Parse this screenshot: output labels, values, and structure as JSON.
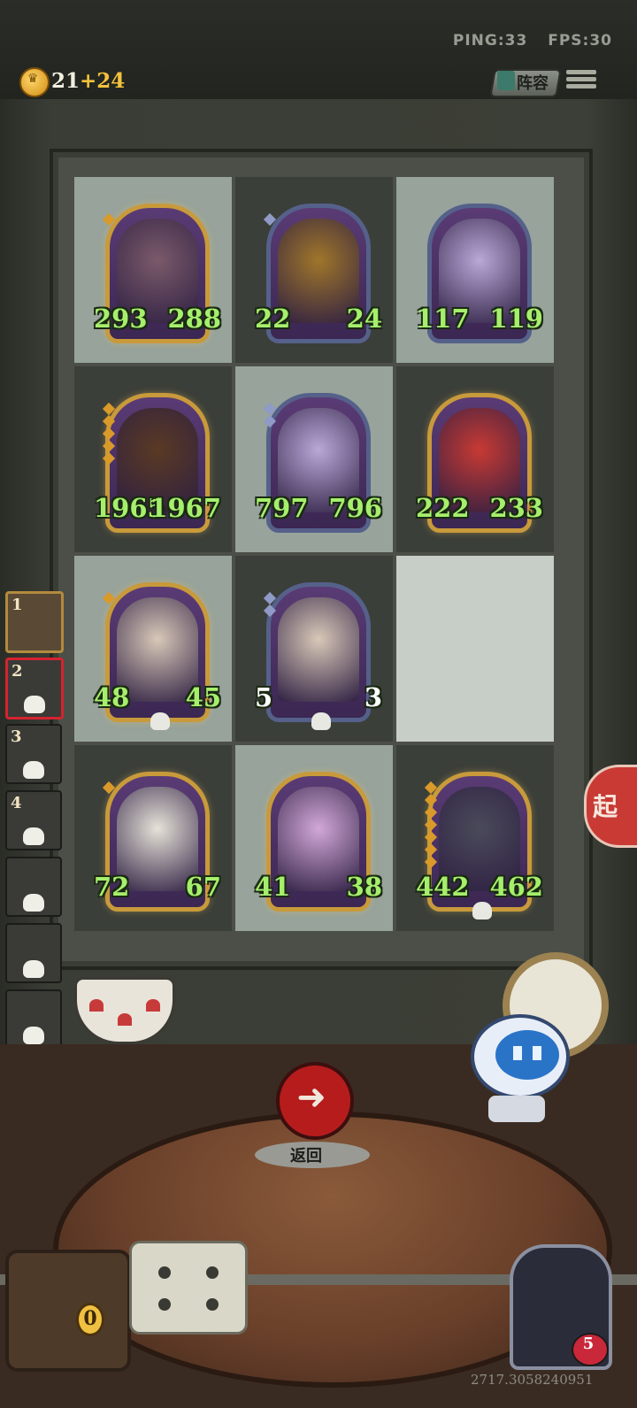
{
  "status": {
    "ping": "PING:33",
    "fps": "FPS:30"
  },
  "economy": {
    "gold": "21",
    "gold_income": "+24"
  },
  "header": {
    "lineup_label": "阵容"
  },
  "board": {
    "cells": [
      {
        "row": 0,
        "col": 0,
        "tone": "light",
        "frame": "gold",
        "stars": 1,
        "creature": "bull-terrier-icon",
        "attack": "293",
        "health": "288",
        "art": "#7a5a6a"
      },
      {
        "row": 0,
        "col": 1,
        "tone": "dark",
        "frame": "silver",
        "stars": 1,
        "creature": "hyena-icon",
        "attack": "22",
        "health": "24",
        "art": "#a0762a"
      },
      {
        "row": 0,
        "col": 2,
        "tone": "light",
        "frame": "silver",
        "stars": 0,
        "creature": "white-fox-icon",
        "attack": "117",
        "health": "119",
        "art": "#b9a8d8"
      },
      {
        "row": 1,
        "col": 0,
        "tone": "dark",
        "frame": "gold",
        "stars": 5,
        "creature": "boar-icon",
        "attack": "1965",
        "health": "1967",
        "art": "#5a3a24"
      },
      {
        "row": 1,
        "col": 1,
        "tone": "light",
        "frame": "silver",
        "stars": 2,
        "creature": "white-fox-icon",
        "attack": "797",
        "health": "796",
        "art": "#b9a8d8"
      },
      {
        "row": 1,
        "col": 2,
        "tone": "dark",
        "frame": "gold",
        "stars": 0,
        "creature": "octopus-icon",
        "attack": "222",
        "health": "233",
        "art": "#c83a34"
      },
      {
        "row": 2,
        "col": 0,
        "tone": "light",
        "frame": "gold",
        "stars": 1,
        "creature": "pelican-icon",
        "attack": "48",
        "health": "45",
        "art": "#d8c8b8",
        "skull": true
      },
      {
        "row": 2,
        "col": 1,
        "tone": "dark",
        "frame": "silver",
        "stars": 2,
        "creature": "pelican-icon",
        "attack": "5",
        "health": "3",
        "art": "#d8c8b8",
        "skull": true,
        "white_stats": true
      },
      {
        "row": 2,
        "col": 2,
        "tone": "pale",
        "empty": true
      },
      {
        "row": 3,
        "col": 0,
        "tone": "dark",
        "frame": "gold",
        "stars": 1,
        "creature": "cow-icon",
        "attack": "72",
        "health": "67",
        "art": "#e6e2d8"
      },
      {
        "row": 3,
        "col": 1,
        "tone": "light",
        "frame": "gold",
        "stars": 0,
        "creature": "tapir-icon",
        "attack": "41",
        "health": "38",
        "art": "#d2a8d8"
      },
      {
        "row": 3,
        "col": 2,
        "tone": "dark",
        "frame": "gold",
        "stars": 7,
        "creature": "pirate-octopus-icon",
        "attack": "442",
        "health": "462",
        "art": "#4a4a5a",
        "skull": true
      }
    ]
  },
  "opponents": [
    {
      "rank": "1",
      "state": "first"
    },
    {
      "rank": "2",
      "state": "active"
    },
    {
      "rank": "3",
      "state": "eliminated"
    },
    {
      "rank": "4",
      "state": "eliminated"
    },
    {
      "rank": "",
      "state": "eliminated"
    },
    {
      "rank": "",
      "state": "eliminated"
    },
    {
      "rank": "",
      "state": "eliminated"
    },
    {
      "rank": "",
      "state": "eliminated"
    }
  ],
  "start_label": "起",
  "back": {
    "label": "返回",
    "icon": "arrow-left-icon"
  },
  "chest": {
    "count": "0",
    "icon": "treasure-chest-icon"
  },
  "player": {
    "avatar_icon": "wolf-butler-icon",
    "health": "5"
  },
  "seed_text": "2717.3058240951",
  "colors": {
    "star_gold": "#d99a2a",
    "stat_green": "#a6ef6d",
    "active_red": "#d5232f"
  }
}
